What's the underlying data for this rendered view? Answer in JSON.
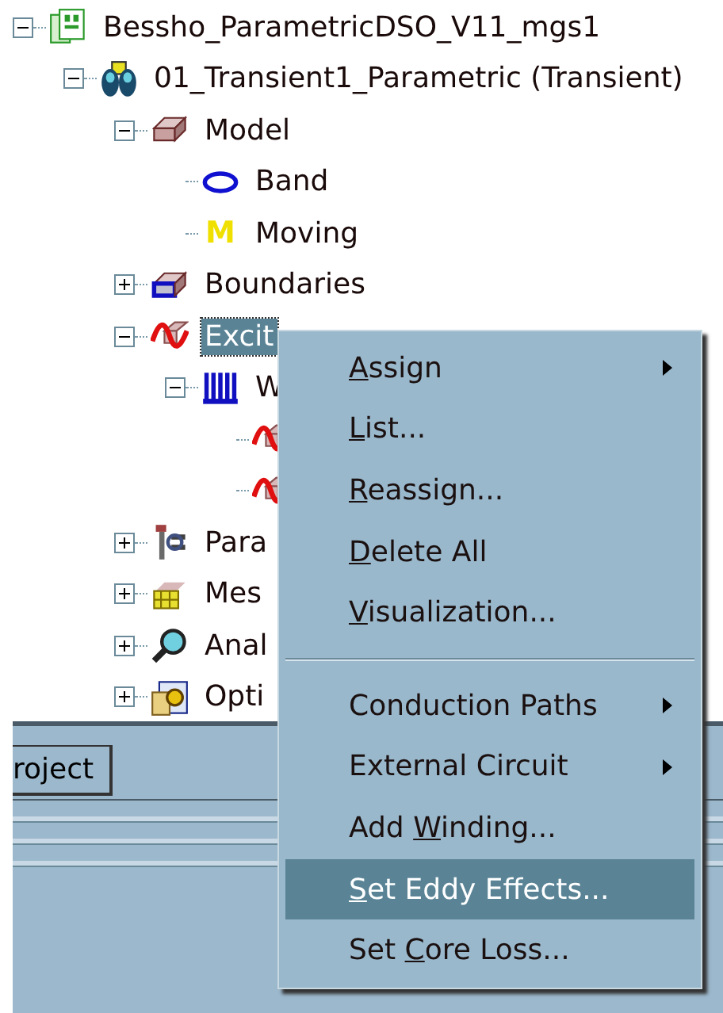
{
  "tree": [
    {
      "label": "Bessho_ParametricDSO_V11_mgs1",
      "kind": "project",
      "expanded": true,
      "selected": false,
      "children": [
        {
          "label": "01_Transient1_Parametric (Transient)",
          "kind": "design",
          "expanded": true,
          "selected": false,
          "children": [
            {
              "label": "Model",
              "kind": "model",
              "expanded": true,
              "selected": false,
              "children": [
                {
                  "label": "Band",
                  "kind": "band",
                  "selected": false
                },
                {
                  "label": "Moving",
                  "kind": "letter",
                  "icon_text": "M",
                  "selected": false
                }
              ]
            },
            {
              "label": "Boundaries",
              "kind": "boundary",
              "expanded": false,
              "selected": false
            },
            {
              "label": "Excit",
              "kind": "excitation",
              "expanded": true,
              "selected": true,
              "children": [
                {
                  "label": "W",
                  "kind": "winding",
                  "expanded": true,
                  "selected": false,
                  "children": [
                    {
                      "kind": "excitation"
                    },
                    {
                      "kind": "excitation"
                    }
                  ]
                }
              ]
            },
            {
              "label": "Para",
              "kind": "parameters",
              "expanded": false,
              "selected": false
            },
            {
              "label": "Mes",
              "kind": "mesh",
              "expanded": false,
              "selected": false
            },
            {
              "label": "Anal",
              "kind": "analysis",
              "expanded": false,
              "selected": false
            },
            {
              "label": "Opti",
              "kind": "optimetrics",
              "expanded": false,
              "selected": false
            }
          ]
        }
      ]
    }
  ],
  "bottom_pane": {
    "tab": "roject"
  },
  "context_menu": [
    {
      "kind": "item",
      "label_parts": [
        {
          "text": "A",
          "underline": true
        },
        {
          "text": "ssign"
        }
      ],
      "submenu": true,
      "selected": false
    },
    {
      "kind": "item",
      "label_parts": [
        {
          "text": "L",
          "underline": true
        },
        {
          "text": "ist..."
        }
      ],
      "selected": false
    },
    {
      "kind": "item",
      "label_parts": [
        {
          "text": "R",
          "underline": true
        },
        {
          "text": "eassign..."
        }
      ],
      "selected": false
    },
    {
      "kind": "item",
      "label_parts": [
        {
          "text": "D",
          "underline": true
        },
        {
          "text": "elete All"
        }
      ],
      "selected": false
    },
    {
      "kind": "item",
      "label_parts": [
        {
          "text": "V",
          "underline": true
        },
        {
          "text": "isualization..."
        }
      ],
      "selected": false
    },
    {
      "kind": "separator"
    },
    {
      "kind": "item",
      "label_parts": [
        {
          "text": "Conduction Paths"
        }
      ],
      "submenu": true,
      "selected": false
    },
    {
      "kind": "item",
      "label_parts": [
        {
          "text": "External Circuit"
        }
      ],
      "submenu": true,
      "selected": false
    },
    {
      "kind": "item",
      "label_parts": [
        {
          "text": "Add "
        },
        {
          "text": "W",
          "underline": true
        },
        {
          "text": "inding..."
        }
      ],
      "selected": false
    },
    {
      "kind": "item",
      "label_parts": [
        {
          "text": "S",
          "underline": true
        },
        {
          "text": "et Eddy Effects..."
        }
      ],
      "selected": true
    },
    {
      "kind": "item",
      "label_parts": [
        {
          "text": "Set "
        },
        {
          "text": "C",
          "underline": true
        },
        {
          "text": "ore Loss..."
        }
      ],
      "selected": false
    }
  ]
}
